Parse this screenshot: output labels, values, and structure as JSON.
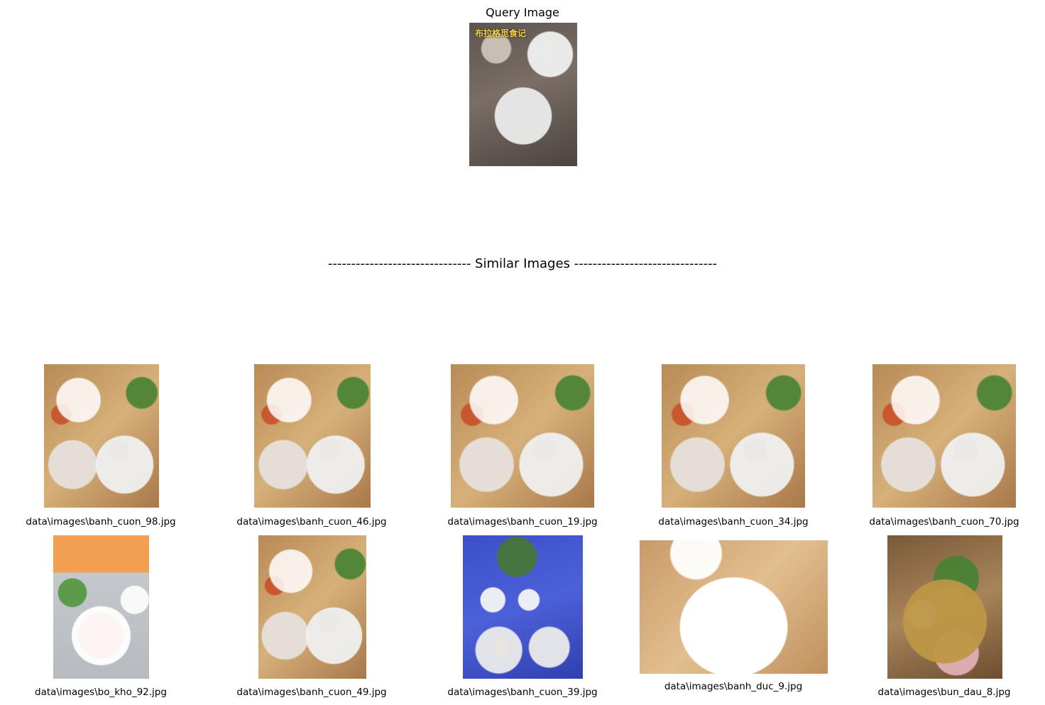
{
  "query": {
    "title": "Query Image",
    "overlay_text": "布拉格觅食记"
  },
  "section_title": "------------------------------- Similar Images -------------------------------",
  "results": [
    {
      "caption": "data\\images\\banh_cuon_98.jpg"
    },
    {
      "caption": "data\\images\\banh_cuon_46.jpg"
    },
    {
      "caption": "data\\images\\banh_cuon_19.jpg"
    },
    {
      "caption": "data\\images\\banh_cuon_34.jpg"
    },
    {
      "caption": "data\\images\\banh_cuon_70.jpg"
    },
    {
      "caption": "data\\images\\bo_kho_92.jpg"
    },
    {
      "caption": "data\\images\\banh_cuon_49.jpg"
    },
    {
      "caption": "data\\images\\banh_cuon_39.jpg"
    },
    {
      "caption": "data\\images\\banh_duc_9.jpg"
    },
    {
      "caption": "data\\images\\bun_dau_8.jpg"
    }
  ]
}
